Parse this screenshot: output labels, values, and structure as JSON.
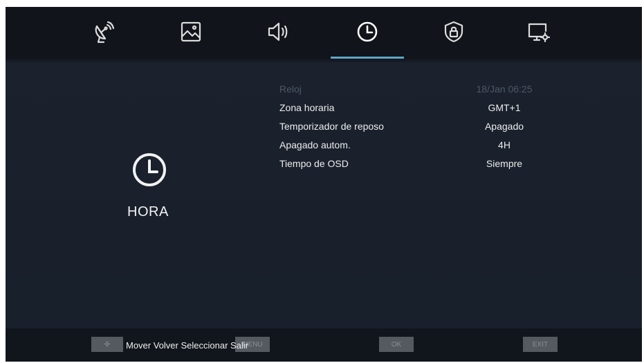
{
  "tabs": [
    {
      "icon": "satellite-dish-icon"
    },
    {
      "icon": "picture-icon"
    },
    {
      "icon": "speaker-icon"
    },
    {
      "icon": "clock-icon",
      "active": true
    },
    {
      "icon": "lock-icon"
    },
    {
      "icon": "monitor-settings-icon"
    }
  ],
  "section": {
    "icon": "clock-icon",
    "title": "HORA"
  },
  "settings": [
    {
      "label": "Reloj",
      "value": "18/Jan  06:25",
      "disabled": true
    },
    {
      "label": "Zona horaria",
      "value": "GMT+1"
    },
    {
      "label": "Temporizador de reposo",
      "value": "Apagado"
    },
    {
      "label": "Apagado autom.",
      "value": "4H"
    },
    {
      "label": "Tiempo de OSD",
      "value": "Siempre"
    }
  ],
  "footer": {
    "keys": {
      "move": "✣",
      "back": "MENU",
      "ok": "OK",
      "exit": "EXIT"
    },
    "hint": "Mover Volver  Seleccionar Salir"
  },
  "colors": {
    "accent": "#5fa7c6",
    "background": "#151a24",
    "topbar": "#11141a"
  }
}
